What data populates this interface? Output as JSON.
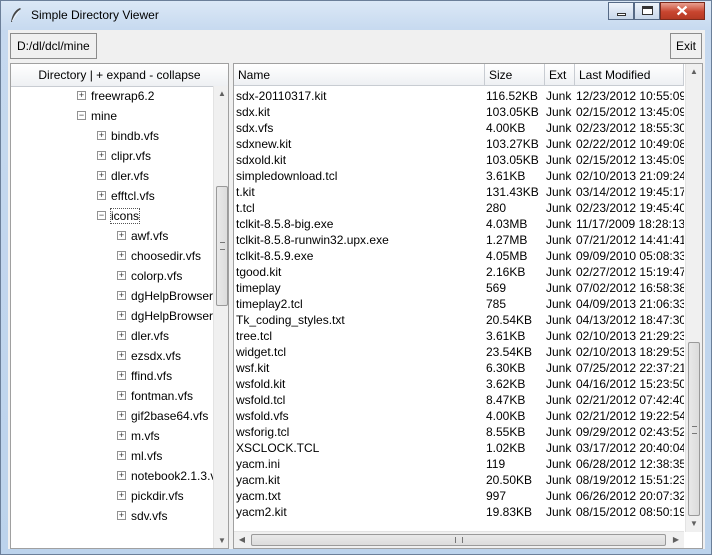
{
  "window": {
    "title": "Simple Directory Viewer"
  },
  "toolbar": {
    "path": "D:/dl/dcl/mine",
    "exit_label": "Exit"
  },
  "tree": {
    "header": "Directory | + expand  - collapse",
    "items": [
      {
        "label": "freewrap6.2",
        "toggle": "+"
      },
      {
        "label": "mine",
        "toggle": "−"
      },
      {
        "label": "bindb.vfs",
        "toggle": "+"
      },
      {
        "label": "clipr.vfs",
        "toggle": "+"
      },
      {
        "label": "dler.vfs",
        "toggle": "+"
      },
      {
        "label": "efftcl.vfs",
        "toggle": "+"
      },
      {
        "label": "icons",
        "toggle": "−"
      },
      {
        "label": "awf.vfs",
        "toggle": "+"
      },
      {
        "label": "choosedir.vfs",
        "toggle": "+"
      },
      {
        "label": "colorp.vfs",
        "toggle": "+"
      },
      {
        "label": "dgHelpBrowser",
        "toggle": "+"
      },
      {
        "label": "dgHelpBrowser",
        "toggle": "+"
      },
      {
        "label": "dler.vfs",
        "toggle": "+"
      },
      {
        "label": "ezsdx.vfs",
        "toggle": "+"
      },
      {
        "label": "ffind.vfs",
        "toggle": "+"
      },
      {
        "label": "fontman.vfs",
        "toggle": "+"
      },
      {
        "label": "gif2base64.vfs",
        "toggle": "+"
      },
      {
        "label": "m.vfs",
        "toggle": "+"
      },
      {
        "label": "ml.vfs",
        "toggle": "+"
      },
      {
        "label": "notebook2.1.3.vfs",
        "toggle": "+"
      },
      {
        "label": "pickdir.vfs",
        "toggle": "+"
      },
      {
        "label": "sdv.vfs",
        "toggle": "+"
      }
    ]
  },
  "files": {
    "columns": [
      "Name",
      "Size",
      "Ext",
      "Last Modified"
    ],
    "rows": [
      [
        "sdx-20110317.kit",
        "116.52KB",
        "Junk",
        "12/23/2012 10:55:09"
      ],
      [
        "sdx.kit",
        "103.05KB",
        "Junk",
        "02/15/2012 13:45:09"
      ],
      [
        "sdx.vfs",
        "4.00KB",
        "Junk",
        "02/23/2012 18:55:30"
      ],
      [
        "sdxnew.kit",
        "103.27KB",
        "Junk",
        "02/22/2012 10:49:08"
      ],
      [
        "sdxold.kit",
        "103.05KB",
        "Junk",
        "02/15/2012 13:45:09"
      ],
      [
        "simpledownload.tcl",
        "3.61KB",
        "Junk",
        "02/10/2013 21:09:24"
      ],
      [
        "t.kit",
        "131.43KB",
        "Junk",
        "03/14/2012 19:45:17"
      ],
      [
        "t.tcl",
        "280",
        "Junk",
        "02/23/2012 19:45:40"
      ],
      [
        "tclkit-8.5.8-big.exe",
        "4.03MB",
        "Junk",
        "11/17/2009 18:28:13"
      ],
      [
        "tclkit-8.5.8-runwin32.upx.exe",
        "1.27MB",
        "Junk",
        "07/21/2012 14:41:41"
      ],
      [
        "tclkit-8.5.9.exe",
        "4.05MB",
        "Junk",
        "09/09/2010 05:08:33"
      ],
      [
        "tgood.kit",
        "2.16KB",
        "Junk",
        "02/27/2012 15:19:47"
      ],
      [
        "timeplay",
        "569",
        "Junk",
        "07/02/2012 16:58:38"
      ],
      [
        "timeplay2.tcl",
        "785",
        "Junk",
        "04/09/2013 21:06:33"
      ],
      [
        "Tk_coding_styles.txt",
        "20.54KB",
        "Junk",
        "04/13/2012 18:47:30"
      ],
      [
        "tree.tcl",
        "3.61KB",
        "Junk",
        "02/10/2013 21:29:23"
      ],
      [
        "widget.tcl",
        "23.54KB",
        "Junk",
        "02/10/2013 18:29:53"
      ],
      [
        "wsf.kit",
        "6.30KB",
        "Junk",
        "07/25/2012 22:37:21"
      ],
      [
        "wsfold.kit",
        "3.62KB",
        "Junk",
        "04/16/2012 15:23:50"
      ],
      [
        "wsfold.tcl",
        "8.47KB",
        "Junk",
        "02/21/2012 07:42:40"
      ],
      [
        "wsfold.vfs",
        "4.00KB",
        "Junk",
        "02/21/2012 19:22:54"
      ],
      [
        "wsforig.tcl",
        "8.55KB",
        "Junk",
        "09/29/2012 02:43:52"
      ],
      [
        "XSCLOCK.TCL",
        "1.02KB",
        "Junk",
        "03/17/2012 20:40:04"
      ],
      [
        "yacm.ini",
        "119",
        "Junk",
        "06/28/2012 12:38:35"
      ],
      [
        "yacm.kit",
        "20.50KB",
        "Junk",
        "08/19/2012 15:51:23"
      ],
      [
        "yacm.txt",
        "997",
        "Junk",
        "06/26/2012 20:07:32"
      ],
      [
        "yacm2.kit",
        "19.83KB",
        "Junk",
        "08/15/2012 08:50:19"
      ]
    ]
  },
  "icons": {
    "app": "feather-icon",
    "minimize": "minimize-icon",
    "maximize": "maximize-icon",
    "close": "close-icon"
  }
}
